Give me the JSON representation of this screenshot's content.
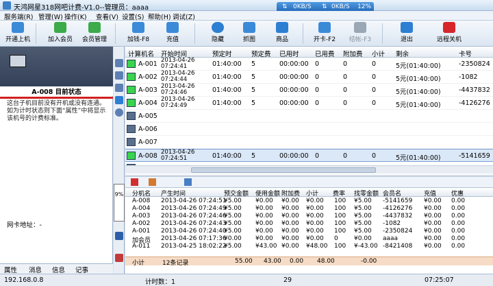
{
  "window": {
    "title": "天鸿网星318网吧计费-V1.0--管理员：aaaa",
    "net_down": "0KB/S",
    "net_up": "0KB/S",
    "net_pct": "12%"
  },
  "menu": [
    "服务端(R)",
    "管理(W)",
    "操作(K)",
    "查看(V)",
    "设置(S)",
    "帮助(H)",
    "调试(Z)"
  ],
  "toolbar": [
    {
      "label": "开通上机",
      "color": "#3b8ad8"
    },
    {
      "label": "加入会员",
      "color": "#3cab4a"
    },
    {
      "label": "会员管理",
      "color": "#3cab4a"
    },
    {
      "label": "加钱-F8",
      "color": "#3b8ad8"
    },
    {
      "label": "充值",
      "color": "#3b8ad8"
    },
    {
      "label": "隐藏",
      "color": "#2d7fd2"
    },
    {
      "label": "抓图",
      "color": "#3b8ad8"
    },
    {
      "label": "商品",
      "color": "#2d7fd2"
    },
    {
      "label": "开卡-F2",
      "color": "#3b8ad8"
    },
    {
      "label": "结帐-F3",
      "color": "#9aa7b5"
    },
    {
      "label": "退出",
      "color": "#2d7fd2"
    },
    {
      "label": "远程关机",
      "color": "#d6262a"
    }
  ],
  "left": {
    "title": "A-008 目前状态",
    "desc": "这台子机目前没有开机或没有连通。如为计时状态则下面“属性”中将显示该机号的计费标准。",
    "ip_label": "网卡地址：-",
    "tabs": [
      "属性",
      "消息",
      "信息",
      "记事"
    ],
    "gauge": "9%"
  },
  "machines": {
    "headers": [
      "计算机名",
      "开始时间",
      "预定时",
      "预定费",
      "已用时",
      "已用费",
      "附加费",
      "小计",
      "剩余",
      "卡号"
    ],
    "rows": [
      {
        "name": "A-001",
        "start_date": "2013-04-26",
        "start_time": "07:24:41",
        "reserve": "01:40:00",
        "fee": "5",
        "used": "00:00:00",
        "used_fee": "0",
        "extra": "0",
        "subtotal": "0",
        "remain": "5元(01:40:00)",
        "card": "-2350824",
        "on": true
      },
      {
        "name": "A-002",
        "start_date": "2013-04-26",
        "start_time": "07:24:44",
        "reserve": "01:40:00",
        "fee": "5",
        "used": "00:00:00",
        "used_fee": "0",
        "extra": "0",
        "subtotal": "0",
        "remain": "5元(01:40:00)",
        "card": "-1082",
        "on": true
      },
      {
        "name": "A-003",
        "start_date": "2013-04-26",
        "start_time": "07:24:46",
        "reserve": "01:40:00",
        "fee": "5",
        "used": "00:00:00",
        "used_fee": "0",
        "extra": "0",
        "subtotal": "0",
        "remain": "5元(01:40:00)",
        "card": "-4437832",
        "on": true
      },
      {
        "name": "A-004",
        "start_date": "2013-04-26",
        "start_time": "07:24:49",
        "reserve": "01:40:00",
        "fee": "5",
        "used": "00:00:00",
        "used_fee": "0",
        "extra": "0",
        "subtotal": "0",
        "remain": "5元(01:40:00)",
        "card": "-4126276",
        "on": true
      },
      {
        "name": "A-005",
        "start_date": "",
        "start_time": "",
        "reserve": "",
        "fee": "",
        "used": "",
        "used_fee": "",
        "extra": "",
        "subtotal": "",
        "remain": "",
        "card": "",
        "on": false
      },
      {
        "name": "A-006",
        "start_date": "",
        "start_time": "",
        "reserve": "",
        "fee": "",
        "used": "",
        "used_fee": "",
        "extra": "",
        "subtotal": "",
        "remain": "",
        "card": "",
        "on": false
      },
      {
        "name": "A-007",
        "start_date": "",
        "start_time": "",
        "reserve": "",
        "fee": "",
        "used": "",
        "used_fee": "",
        "extra": "",
        "subtotal": "",
        "remain": "",
        "card": "",
        "on": false
      },
      {
        "name": "A-008",
        "start_date": "2013-04-26",
        "start_time": "07:24:51",
        "reserve": "01:40:00",
        "fee": "5",
        "used": "00:00:00",
        "used_fee": "0",
        "extra": "0",
        "subtotal": "0",
        "remain": "5元(01:40:00)",
        "card": "-5141659",
        "on": true
      },
      {
        "name": "A-009",
        "start_date": "",
        "start_time": "",
        "reserve": "",
        "fee": "",
        "used": "",
        "used_fee": "",
        "extra": "",
        "subtotal": "",
        "remain": "",
        "card": "",
        "on": false
      }
    ]
  },
  "records": {
    "headers": [
      "分机名",
      "产生时间",
      "预交金额",
      "使用金额",
      "附加费",
      "小计",
      "费率",
      "找零金额",
      "会员名",
      "充值",
      "优惠"
    ],
    "rows": [
      [
        "A-008",
        "2013-04-26 07:24:51",
        "¥5.00",
        "¥0.00",
        "¥0.00",
        "¥0.00",
        "100",
        "¥5.00",
        "-5141659",
        "¥0.00",
        "0.00"
      ],
      [
        "A-004",
        "2013-04-26 07:24:49",
        "¥5.00",
        "¥0.00",
        "¥0.00",
        "¥0.00",
        "100",
        "¥5.00",
        "-4126276",
        "¥0.00",
        "0.00"
      ],
      [
        "A-003",
        "2013-04-26 07:24:46",
        "¥5.00",
        "¥0.00",
        "¥0.00",
        "¥0.00",
        "100",
        "¥5.00",
        "-4437832",
        "¥0.00",
        "0.00"
      ],
      [
        "A-002",
        "2013-04-26 07:24:43",
        "¥5.00",
        "¥0.00",
        "¥0.00",
        "¥0.00",
        "100",
        "¥5.00",
        "-1082",
        "¥0.00",
        "0.00"
      ],
      [
        "A-001",
        "2013-04-26 07:24:40",
        "¥5.00",
        "¥0.00",
        "¥0.00",
        "¥0.00",
        "100",
        "¥5.00",
        "-2350824",
        "¥0.00",
        "0.00"
      ],
      [
        "加会员",
        "2013-04-26 07:17:36",
        "¥0.00",
        "¥0.00",
        "¥0.00",
        "¥0.00",
        "0",
        "¥0.00",
        "aaaa",
        "¥0.00",
        "0.00"
      ],
      [
        "A-011",
        "2013-04-25 18:02:22",
        "¥5.00",
        "¥43.00",
        "¥0.00",
        "¥48.00",
        "100",
        "¥-43.00",
        "-8421408",
        "¥0.00",
        "0.00"
      ]
    ],
    "summary": {
      "label": "小计",
      "count": "12条记录",
      "prepaid": "55.00",
      "used": "43.00",
      "extra": "0.00",
      "subtotal": "48.00",
      "change": "-0.00"
    }
  },
  "status": {
    "ip": "192.168.0.8",
    "count_label": "计时数：1",
    "count2": "29",
    "time": "07:25:07"
  }
}
